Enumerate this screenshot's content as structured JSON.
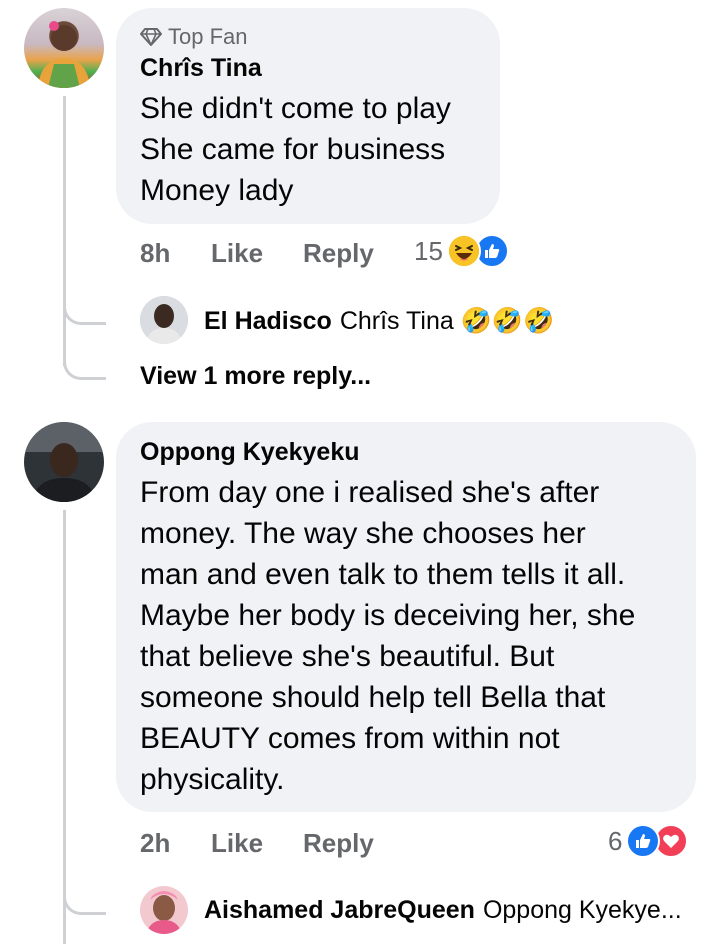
{
  "comments": [
    {
      "badge": "Top Fan",
      "author": "Chrîs Tina",
      "lines": [
        "She didn't come to play",
        "She came for business",
        "Money lady"
      ],
      "time": "8h",
      "like_label": "Like",
      "reply_label": "Reply",
      "reaction_count": "15",
      "reactions": [
        "haha-icon",
        "like-icon"
      ],
      "reply_preview": {
        "author": "El Hadisco",
        "text": "Chrîs Tina 🤣🤣🤣"
      },
      "view_more": "View 1 more reply..."
    },
    {
      "author": "Oppong Kyekyeku",
      "lines": [
        "From day one i realised she's after",
        "money. The way she chooses her",
        "man and even talk to them tells it all.",
        "Maybe her body is deceiving her, she",
        "that believe she's beautiful. But",
        "someone should help tell Bella that",
        "BEAUTY comes from within not",
        "physicality."
      ],
      "time": "2h",
      "like_label": "Like",
      "reply_label": "Reply",
      "reaction_count": "6",
      "reactions": [
        "like-icon",
        "love-icon"
      ],
      "reply_preview": {
        "author": "Aishamed JabreQueen",
        "text": "Oppong Kyekye..."
      }
    }
  ],
  "colors": {
    "like_blue": "#1877f2",
    "love_red": "#f33e58",
    "haha_yellow": "#f7b125",
    "bubble_bg": "#f0f2f5",
    "meta_gray": "#65676b"
  }
}
